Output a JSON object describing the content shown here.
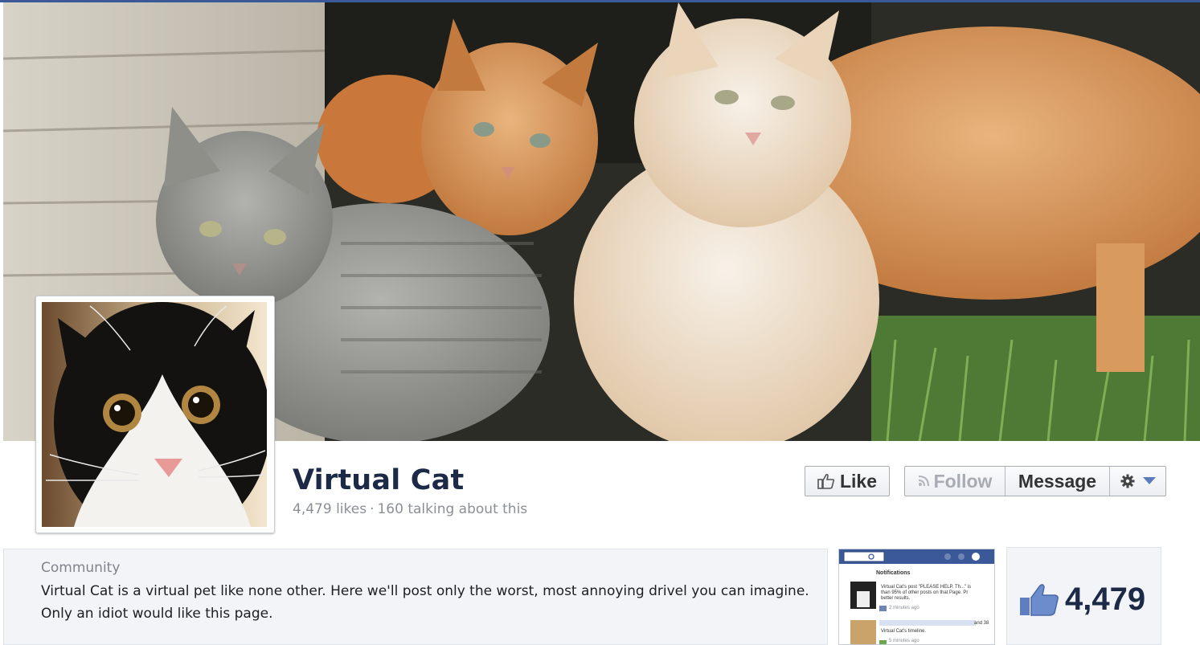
{
  "page": {
    "name": "Virtual Cat",
    "likes_text": "4,479 likes",
    "talking_text": "160 talking about this",
    "separator": "·"
  },
  "actions": {
    "like_label": "Like",
    "follow_label": "Follow",
    "message_label": "Message"
  },
  "about": {
    "category": "Community",
    "description": "Virtual Cat is a virtual pet like none other. Here we'll post only the worst, most annoying drivel you can imagine. Only an idiot would like this page."
  },
  "likes_box": {
    "count": "4,479"
  },
  "thumbnail": {
    "header": "Notifications",
    "item1_text": "Virtual Cat's post \"PLEASE HELP. Th...\" is",
    "item1_text2": "than 95% of other posts on that Page. Pr",
    "item1_text3": "better results.",
    "item1_time": "2 minutes ago",
    "item2_extra": "and 38",
    "item2_text": "Virtual Cat's timeline.",
    "item2_time": "5 minutes ago"
  },
  "colors": {
    "brand": "#3b5998",
    "name": "#1c2a47",
    "muted": "#8b8f96"
  },
  "icons": [
    "thumbs-up-icon",
    "rss-icon",
    "gear-icon",
    "caret-down-icon",
    "search-icon"
  ]
}
